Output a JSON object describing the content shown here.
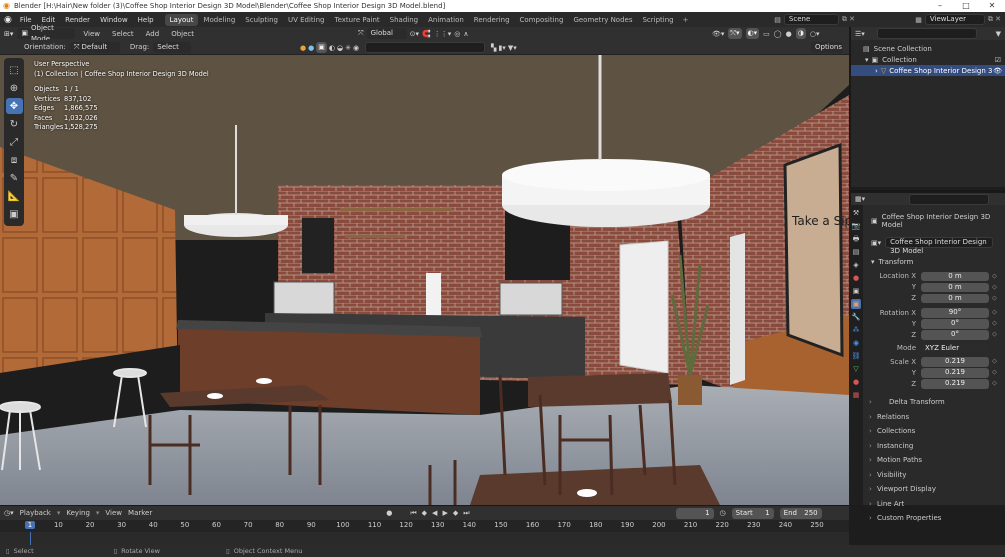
{
  "window": {
    "title": "Blender [H:\\Hair\\New folder (3)\\Coffee Shop Interior Design 3D Model\\Blender\\Coffee Shop Interior Design 3D Model.blend]"
  },
  "menu": [
    "File",
    "Edit",
    "Render",
    "Window",
    "Help"
  ],
  "workspaces": [
    "Layout",
    "Modeling",
    "Sculpting",
    "UV Editing",
    "Texture Paint",
    "Shading",
    "Animation",
    "Rendering",
    "Compositing",
    "Geometry Nodes",
    "Scripting"
  ],
  "scene": {
    "scene_label": "Scene",
    "view_layer": "ViewLayer"
  },
  "viewport_header": {
    "mode": "Object Mode",
    "view": "View",
    "select": "Select",
    "add": "Add",
    "object": "Object",
    "orientation_label": "Orientation:",
    "orientation_value": "Default",
    "drag_label": "Drag:",
    "drag_value": "Select Box",
    "transform_orientation": "Global",
    "options": "Options"
  },
  "overlay": {
    "view_name": "User Perspective",
    "collection_line": "(1) Collection | Coffee Shop Interior Design 3D Model",
    "stats": [
      {
        "k": "Objects",
        "v": "1 / 1"
      },
      {
        "k": "Vertices",
        "v": "837,102"
      },
      {
        "k": "Edges",
        "v": "1,866,575"
      },
      {
        "k": "Faces",
        "v": "1,032,026"
      },
      {
        "k": "Triangles",
        "v": "1,528,275"
      }
    ],
    "sign_text": "Take a Sip"
  },
  "gizmo": {
    "x": "X",
    "y": "Y",
    "z": "Z"
  },
  "outliner": {
    "root": "Scene Collection",
    "collection": "Collection",
    "object": "Coffee Shop Interior Design 3D Mod"
  },
  "properties": {
    "object_name": "Coffee Shop Interior Design 3D Model",
    "data_name": "Coffee Shop Interior Design 3D Model",
    "transform_title": "Transform",
    "rows": [
      {
        "label": "Location X",
        "value": "0 m"
      },
      {
        "label": "Y",
        "value": "0 m"
      },
      {
        "label": "Z",
        "value": "0 m"
      },
      {
        "label": "Rotation X",
        "value": "90°"
      },
      {
        "label": "Y",
        "value": "0°"
      },
      {
        "label": "Z",
        "value": "0°"
      }
    ],
    "mode_label": "Mode",
    "mode_value": "XYZ Euler",
    "scale_rows": [
      {
        "label": "Scale X",
        "value": "0.219"
      },
      {
        "label": "Y",
        "value": "0.219"
      },
      {
        "label": "Z",
        "value": "0.219"
      }
    ],
    "sections": [
      "Delta Transform",
      "Relations",
      "Collections",
      "Instancing",
      "Motion Paths",
      "Visibility",
      "Viewport Display",
      "Line Art",
      "Custom Properties"
    ]
  },
  "timeline": {
    "playback": "Playback",
    "keying": "Keying",
    "view": "View",
    "marker": "Marker",
    "current_frame": "1",
    "start_label": "Start",
    "start": "1",
    "end_label": "End",
    "end": "250",
    "ticks": [
      "1",
      "10",
      "20",
      "30",
      "40",
      "50",
      "60",
      "70",
      "80",
      "90",
      "100",
      "110",
      "120",
      "130",
      "140",
      "150",
      "160",
      "170",
      "180",
      "190",
      "200",
      "210",
      "220",
      "230",
      "240",
      "250"
    ]
  },
  "statusbar": {
    "select": "Select",
    "rotate": "Rotate View",
    "context": "Object Context Menu"
  },
  "colors": {
    "accent": "#4772b3",
    "header": "#303030",
    "panel": "#2a2a2a",
    "selected_row": "#334d80"
  }
}
